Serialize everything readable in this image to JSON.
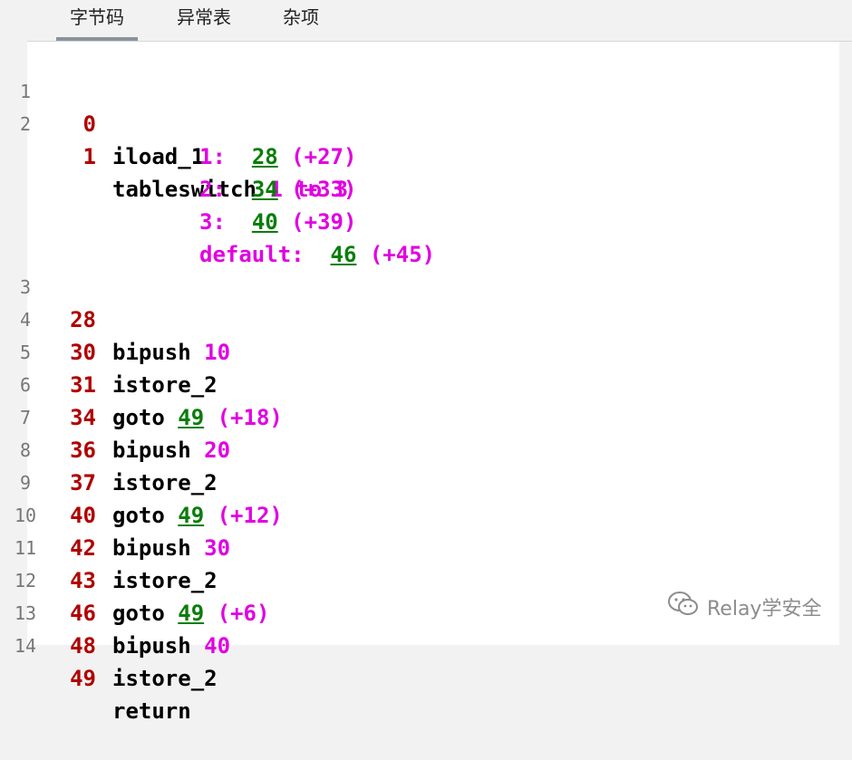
{
  "tabs": [
    {
      "label": "字节码",
      "active": true
    },
    {
      "label": "异常表",
      "active": false
    },
    {
      "label": "杂项",
      "active": false
    }
  ],
  "code": [
    {
      "ln": "1",
      "off": "0",
      "ins": "iload_1"
    },
    {
      "ln": "2",
      "off": "1",
      "ins": "tableswitch",
      "arg": "1 to 3"
    },
    {
      "ln": "3",
      "off": "28",
      "ins": "bipush",
      "arg": "10"
    },
    {
      "ln": "4",
      "off": "30",
      "ins": "istore_2"
    },
    {
      "ln": "5",
      "off": "31",
      "ins": "goto",
      "target": "49",
      "delta": "(+18)"
    },
    {
      "ln": "6",
      "off": "34",
      "ins": "bipush",
      "arg": "20"
    },
    {
      "ln": "7",
      "off": "36",
      "ins": "istore_2"
    },
    {
      "ln": "8",
      "off": "37",
      "ins": "goto",
      "target": "49",
      "delta": "(+12)"
    },
    {
      "ln": "9",
      "off": "40",
      "ins": "bipush",
      "arg": "30"
    },
    {
      "ln": "10",
      "off": "42",
      "ins": "istore_2"
    },
    {
      "ln": "11",
      "off": "43",
      "ins": "goto",
      "target": "49",
      "delta": "(+6)"
    },
    {
      "ln": "12",
      "off": "46",
      "ins": "bipush",
      "arg": "40"
    },
    {
      "ln": "13",
      "off": "48",
      "ins": "istore_2"
    },
    {
      "ln": "14",
      "off": "49",
      "ins": "return"
    }
  ],
  "switch_cases": [
    {
      "key": "1:",
      "target": "28",
      "delta": "(+27)"
    },
    {
      "key": "2:",
      "target": "34",
      "delta": "(+33)"
    },
    {
      "key": "3:",
      "target": "40",
      "delta": "(+39)"
    },
    {
      "key": "default:",
      "target": "46",
      "delta": "(+45)"
    }
  ],
  "watermark": {
    "text": "Relay学安全",
    "icon": "wechat-icon"
  },
  "colors": {
    "offset": "#b00000",
    "operand": "#e100e1",
    "jump_target": "#0a7d0a",
    "instruction": "#000000"
  }
}
